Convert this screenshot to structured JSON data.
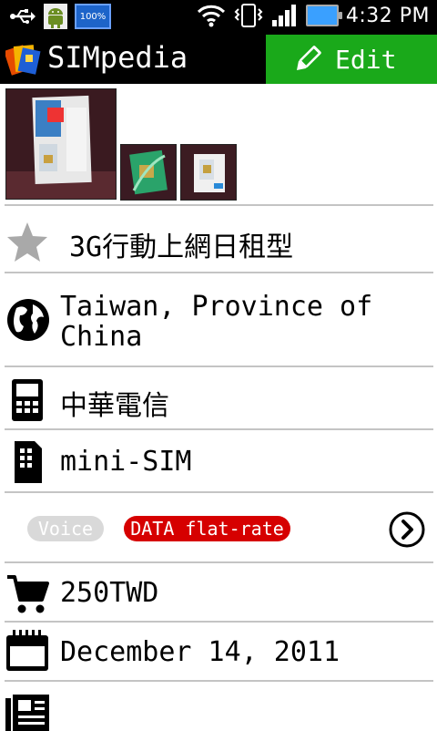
{
  "status_bar": {
    "time": "4:32 PM",
    "battery_label": "100%"
  },
  "app": {
    "title": "SIMpedia",
    "edit_label": "Edit",
    "accent": "#1aa91a"
  },
  "sim": {
    "name": "3G行動上網日租型",
    "country": "Taiwan, Province of China",
    "carrier": "中華電信",
    "sim_type": "mini-SIM",
    "features": [
      "Voice",
      "DATA flat-rate"
    ],
    "price": "250TWD",
    "date": "December 14, 2011"
  }
}
